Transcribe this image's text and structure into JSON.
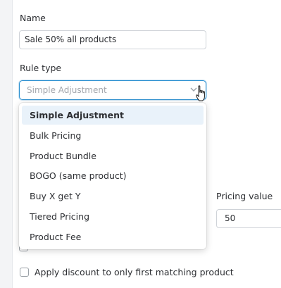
{
  "form": {
    "name_label": "Name",
    "name_value": "Sale 50% all products",
    "rule_type_label": "Rule type",
    "rule_type_placeholder": "Simple Adjustment",
    "pricing_value_label": "Pricing value",
    "pricing_value": "50",
    "first_match_label": "Apply discount to only first matching product"
  },
  "dropdown": {
    "options": [
      {
        "label": "Simple Adjustment",
        "selected": true
      },
      {
        "label": "Bulk Pricing",
        "selected": false
      },
      {
        "label": "Product Bundle",
        "selected": false
      },
      {
        "label": "BOGO (same product)",
        "selected": false
      },
      {
        "label": "Buy X get Y",
        "selected": false
      },
      {
        "label": "Tiered Pricing",
        "selected": false
      },
      {
        "label": "Product Fee",
        "selected": false
      }
    ]
  },
  "colors": {
    "focus_border": "#2a8fd0",
    "selected_option_bg": "#e9f2fa"
  },
  "icons": {
    "select_arrow": "chevron-down-icon",
    "cursor": "hand-pointer-icon"
  }
}
